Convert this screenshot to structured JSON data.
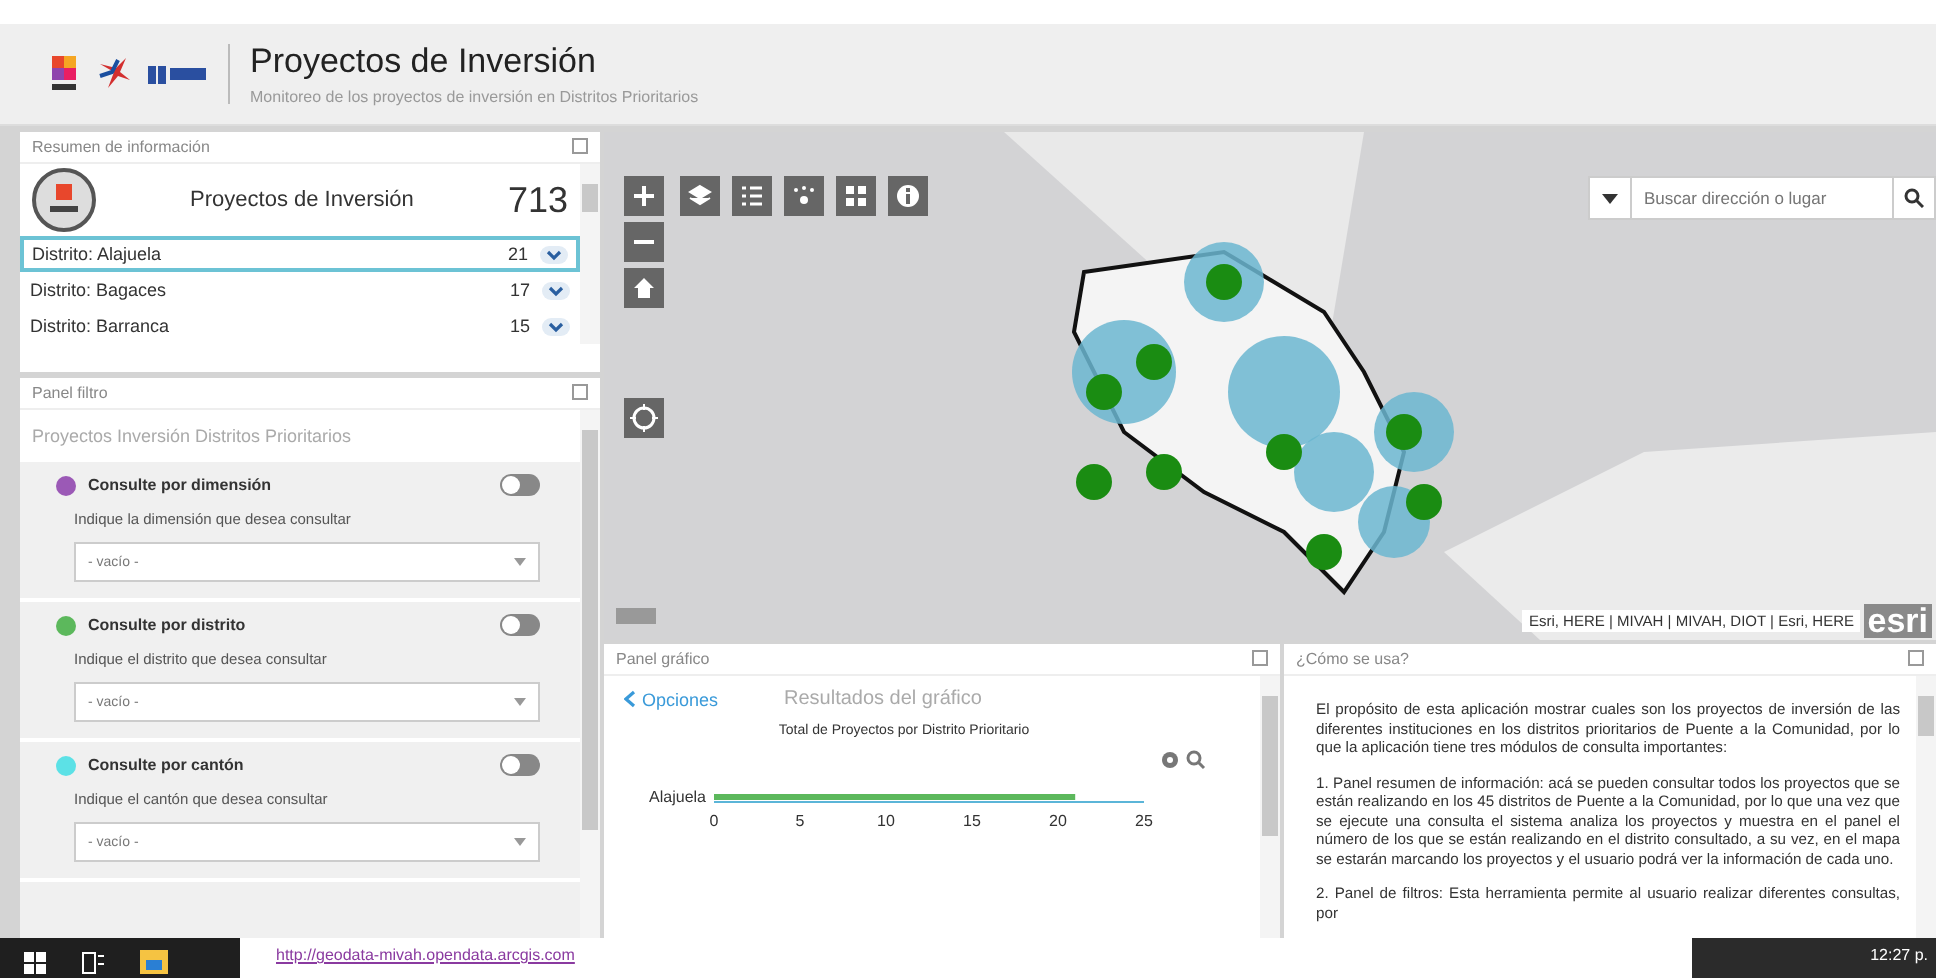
{
  "header": {
    "title": "Proyectos de Inversión",
    "subtitle": "Monitoreo de los proyectos de inversión en Distritos Prioritarios"
  },
  "summary": {
    "panel_title": "Resumen de información",
    "title": "Proyectos de Inversión",
    "total": "713",
    "rows": [
      {
        "label": "Distrito: Alajuela",
        "count": "21",
        "selected": true
      },
      {
        "label": "Distrito: Bagaces",
        "count": "17",
        "selected": false
      },
      {
        "label": "Distrito: Barranca",
        "count": "15",
        "selected": false
      }
    ]
  },
  "filter": {
    "panel_title": "Panel filtro",
    "heading": "Proyectos Inversión Distritos Prioritarios",
    "sections": [
      {
        "label": "Consulte por dimensión",
        "color": "#9b59b6",
        "on": false,
        "prompt": "Indique la dimensión que desea consultar",
        "value": "- vacío -"
      },
      {
        "label": "Consulte por distrito",
        "color": "#5cb85c",
        "on": false,
        "prompt": "Indique el distrito que desea consultar",
        "value": "- vacío -"
      },
      {
        "label": "Consulte por cantón",
        "color": "#5ce1e6",
        "on": false,
        "prompt": "Indique el cantón que desea consultar",
        "value": "- vacío -"
      }
    ]
  },
  "map": {
    "search_placeholder": "Buscar dirección o lugar",
    "attribution": "Esri, HERE | MIVAH | MIVAH, DIOT | Esri, HERE",
    "logo": "esri"
  },
  "chart_panel": {
    "panel_title": "Panel gráfico",
    "back_link": "Opciones",
    "title": "Resultados del gráfico",
    "chart_data": {
      "type": "bar",
      "orientation": "horizontal",
      "title": "Total de Proyectos por Distrito Prioritario",
      "categories": [
        "Alajuela"
      ],
      "values": [
        21
      ],
      "xlim": [
        0,
        25
      ],
      "xticks": [
        0,
        5,
        10,
        15,
        20,
        25
      ]
    }
  },
  "help": {
    "panel_title": "¿Cómo se usa?",
    "paragraphs": [
      "El propósito de esta aplicación mostrar cuales son los proyectos de inversión de las diferentes instituciones en los distritos prioritarios de Puente a la Comunidad, por lo que la aplicación tiene tres módulos de consulta importantes:",
      "1. Panel resumen de información: acá se pueden consultar todos los proyectos que se están realizando en los 45 distritos de Puente a la Comunidad, por lo que una vez que se ejecute una consulta el sistema analiza los proyectos y muestra en el panel el número de los que se están realizando en el distrito consultado, a su vez, en el mapa se estarán marcando los proyectos y el usuario podrá ver la información de cada uno.",
      "2. Panel de filtros: Esta herramienta permite al usuario realizar diferentes consultas, por"
    ]
  },
  "taskbar": {
    "link": "http://geodata-mivah.opendata.arcgis.com",
    "time": "12:27 p."
  }
}
